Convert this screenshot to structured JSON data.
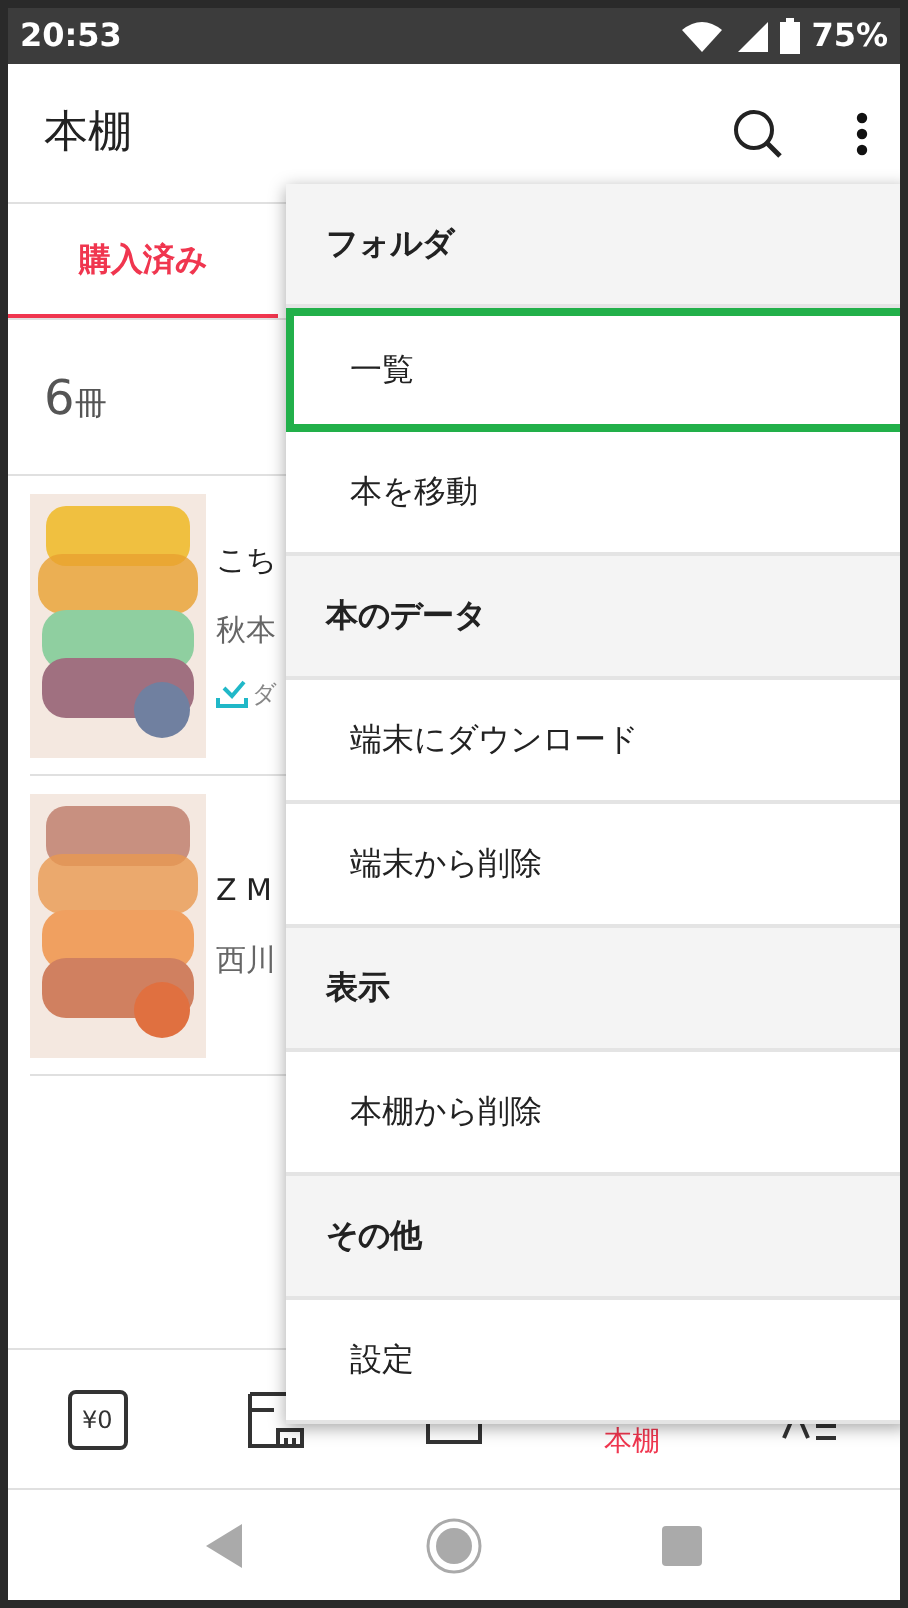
{
  "status_bar": {
    "time": "20:53",
    "battery": "75%"
  },
  "app_bar": {
    "title": "本棚"
  },
  "tabs": [
    {
      "label": "購入済み",
      "selected": true
    }
  ],
  "count": {
    "number": "6",
    "unit": "冊"
  },
  "books": [
    {
      "title": "こち",
      "author": "秋本",
      "downloaded": true,
      "status": "ダ"
    },
    {
      "title": "Z M",
      "author": "西川",
      "downloaded": false
    }
  ],
  "menu": [
    {
      "kind": "header",
      "label": "フォルダ"
    },
    {
      "kind": "item",
      "label": "一覧",
      "selected": true
    },
    {
      "kind": "item",
      "label": "本を移動",
      "selected": false
    },
    {
      "kind": "header",
      "label": "本のデータ"
    },
    {
      "kind": "item",
      "label": "端末にダウンロード",
      "selected": false
    },
    {
      "kind": "item",
      "label": "端末から削除",
      "selected": false
    },
    {
      "kind": "header",
      "label": "表示"
    },
    {
      "kind": "item",
      "label": "本棚から削除",
      "selected": false
    },
    {
      "kind": "header",
      "label": "その他"
    },
    {
      "kind": "item",
      "label": "設定",
      "selected": false
    }
  ],
  "bottom_nav": [
    {
      "kind": "coupon",
      "icon_text": "¥0",
      "selected": false
    },
    {
      "kind": "store",
      "selected": false
    },
    {
      "kind": "box",
      "selected": false
    },
    {
      "kind": "shelf",
      "label": "本棚",
      "selected": true
    },
    {
      "kind": "more",
      "selected": false
    }
  ]
}
